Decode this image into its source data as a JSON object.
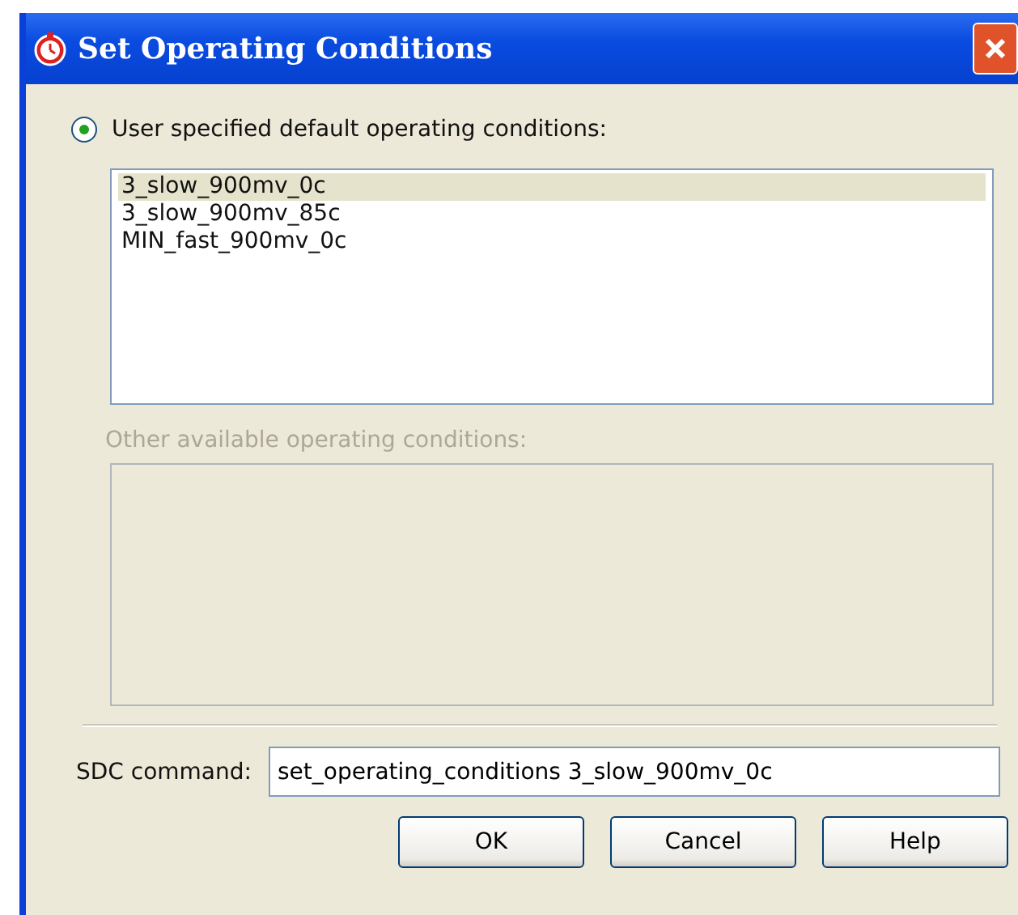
{
  "window": {
    "title": "Set Operating Conditions"
  },
  "default_conditions": {
    "label": "User specified default operating conditions:",
    "checked": true,
    "items": [
      {
        "label": "3_slow_900mv_0c",
        "selected": true
      },
      {
        "label": "3_slow_900mv_85c",
        "selected": false
      },
      {
        "label": "MIN_fast_900mv_0c",
        "selected": false
      }
    ]
  },
  "other_conditions": {
    "label": "Other available operating conditions:",
    "disabled": true
  },
  "sdc_command": {
    "label": "SDC command:",
    "value": "set_operating_conditions 3_slow_900mv_0c"
  },
  "buttons": [
    "OK",
    "Cancel",
    "Help"
  ]
}
